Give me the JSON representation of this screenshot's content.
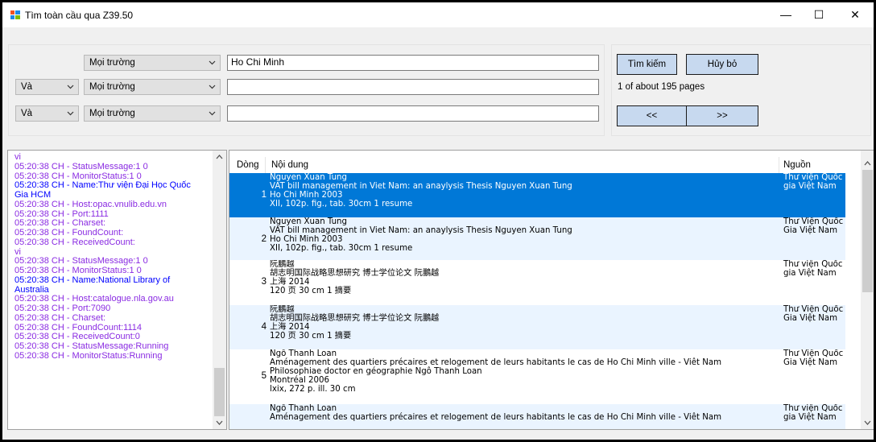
{
  "window": {
    "title": "Tìm toàn cầu qua Z39.50",
    "minimize": "—",
    "maximize": "☐",
    "close": "✕"
  },
  "search": {
    "rows": [
      {
        "op": "",
        "field": "Mọi trường",
        "value": "Ho Chi Minh"
      },
      {
        "op": "Và",
        "field": "Mọi trường",
        "value": ""
      },
      {
        "op": "Và",
        "field": "Mọi trường",
        "value": ""
      }
    ],
    "search_label": "Tìm kiếm",
    "cancel_label": "Hủy bỏ",
    "page_status": "1 of about 195 pages",
    "prev_label": "<<",
    "next_label": ">>"
  },
  "log": [
    {
      "text": "vi",
      "color": "#8a2be2"
    },
    {
      "text": "05:20:38 CH - StatusMessage:1 0",
      "color": "#8a2be2"
    },
    {
      "text": "05:20:38 CH - MonitorStatus:1 0",
      "color": "#8a2be2"
    },
    {
      "text": "05:20:38 CH - Name:Thư viện Đại Học Quốc",
      "color": "#0000ff"
    },
    {
      "text": "Gia HCM",
      "color": "#0000ff"
    },
    {
      "text": "05:20:38 CH - Host:opac.vnulib.edu.vn",
      "color": "#8a2be2"
    },
    {
      "text": "05:20:38 CH - Port:1111",
      "color": "#8a2be2"
    },
    {
      "text": "05:20:38 CH - Charset:",
      "color": "#8a2be2"
    },
    {
      "text": "05:20:38 CH - FoundCount:",
      "color": "#8a2be2"
    },
    {
      "text": "05:20:38 CH - ReceivedCount:",
      "color": "#8a2be2"
    },
    {
      "text": "vi",
      "color": "#8a2be2"
    },
    {
      "text": "05:20:38 CH - StatusMessage:1 0",
      "color": "#8a2be2"
    },
    {
      "text": "05:20:38 CH - MonitorStatus:1 0",
      "color": "#8a2be2"
    },
    {
      "text": "05:20:38 CH - Name:National Library of",
      "color": "#0000ff"
    },
    {
      "text": "Australia",
      "color": "#0000ff"
    },
    {
      "text": "05:20:38 CH - Host:catalogue.nla.gov.au",
      "color": "#8a2be2"
    },
    {
      "text": "05:20:38 CH - Port:7090",
      "color": "#8a2be2"
    },
    {
      "text": "05:20:38 CH - Charset:",
      "color": "#8a2be2"
    },
    {
      "text": "05:20:38 CH - FoundCount:1114",
      "color": "#8a2be2"
    },
    {
      "text": "05:20:38 CH - ReceivedCount:0",
      "color": "#8a2be2"
    },
    {
      "text": "05:20:38 CH - StatusMessage:Running",
      "color": "#8a2be2"
    },
    {
      "text": "05:20:38 CH - MonitorStatus:Running",
      "color": "#8a2be2"
    }
  ],
  "results": {
    "columns": {
      "row": "Dòng",
      "content": "Nội dung",
      "source": "Nguồn"
    },
    "rows": [
      {
        "num": "1",
        "lines": [
          "Nguyen Xuan Tung",
          "VAT bill management in Viet Nam: an anaylysis Thesis Nguyen Xuan Tung",
          "Ho Chi Minh 2003",
          "XII, 102p. fig., tab. 30cm 1 resume"
        ],
        "source": [
          "Thư viện Quốc",
          "gia Việt Nam"
        ],
        "selected": true
      },
      {
        "num": "2",
        "lines": [
          "Nguyen Xuan Tung",
          "VAT bill management in Viet Nam: an anaylysis Thesis Nguyen Xuan Tung",
          "Ho Chi Minh 2003",
          "XII, 102p. fig., tab. 30cm 1 resume"
        ],
        "source": [
          "Thư Viện Quốc",
          "Gia Việt Nam"
        ],
        "selected": false
      },
      {
        "num": "3",
        "lines": [
          "阮鵬越",
          "胡志明国际战略思想研究 博士学位论文 阮鵬越",
          "上海 2014",
          "120 页 30 cm 1 摘要"
        ],
        "source": [
          "Thư viện Quốc",
          "gia Việt Nam"
        ],
        "selected": false
      },
      {
        "num": "4",
        "lines": [
          "阮鵬越",
          "胡志明国际战略思想研究 博士学位论文 阮鵬越",
          "上海 2014",
          "120 页 30 cm 1 摘要"
        ],
        "source": [
          "Thư Viện Quốc",
          "Gia Việt Nam"
        ],
        "selected": false
      },
      {
        "num": "5",
        "lines": [
          "Ngô Thanh Loan",
          "Aménagement des quartiers précaires et relogement de leurs habitants le cas de Ho Chi Minh ville - Viêt Nam",
          "Philosophiae doctor en géographie Ngô Thanh Loan",
          "Montréal 2006",
          "lxix, 272 p. ill. 30 cm"
        ],
        "source": [
          "Thư Viện Quốc",
          "Gia Việt Nam"
        ],
        "selected": false
      },
      {
        "num": "",
        "lines": [
          "Ngô Thanh Loan",
          "Aménagement des quartiers précaires et relogement de leurs habitants le cas de Ho Chi Minh ville - Viêt Nam"
        ],
        "source": [
          "Thư viện Quốc",
          "gia Việt Nam"
        ],
        "selected": false
      }
    ]
  },
  "colors": {
    "selection": "#0078d7",
    "alt_row": "#eaf4ff",
    "log_purple": "#8a2be2",
    "log_blue": "#0000ff",
    "button": "#c7d9ef"
  }
}
